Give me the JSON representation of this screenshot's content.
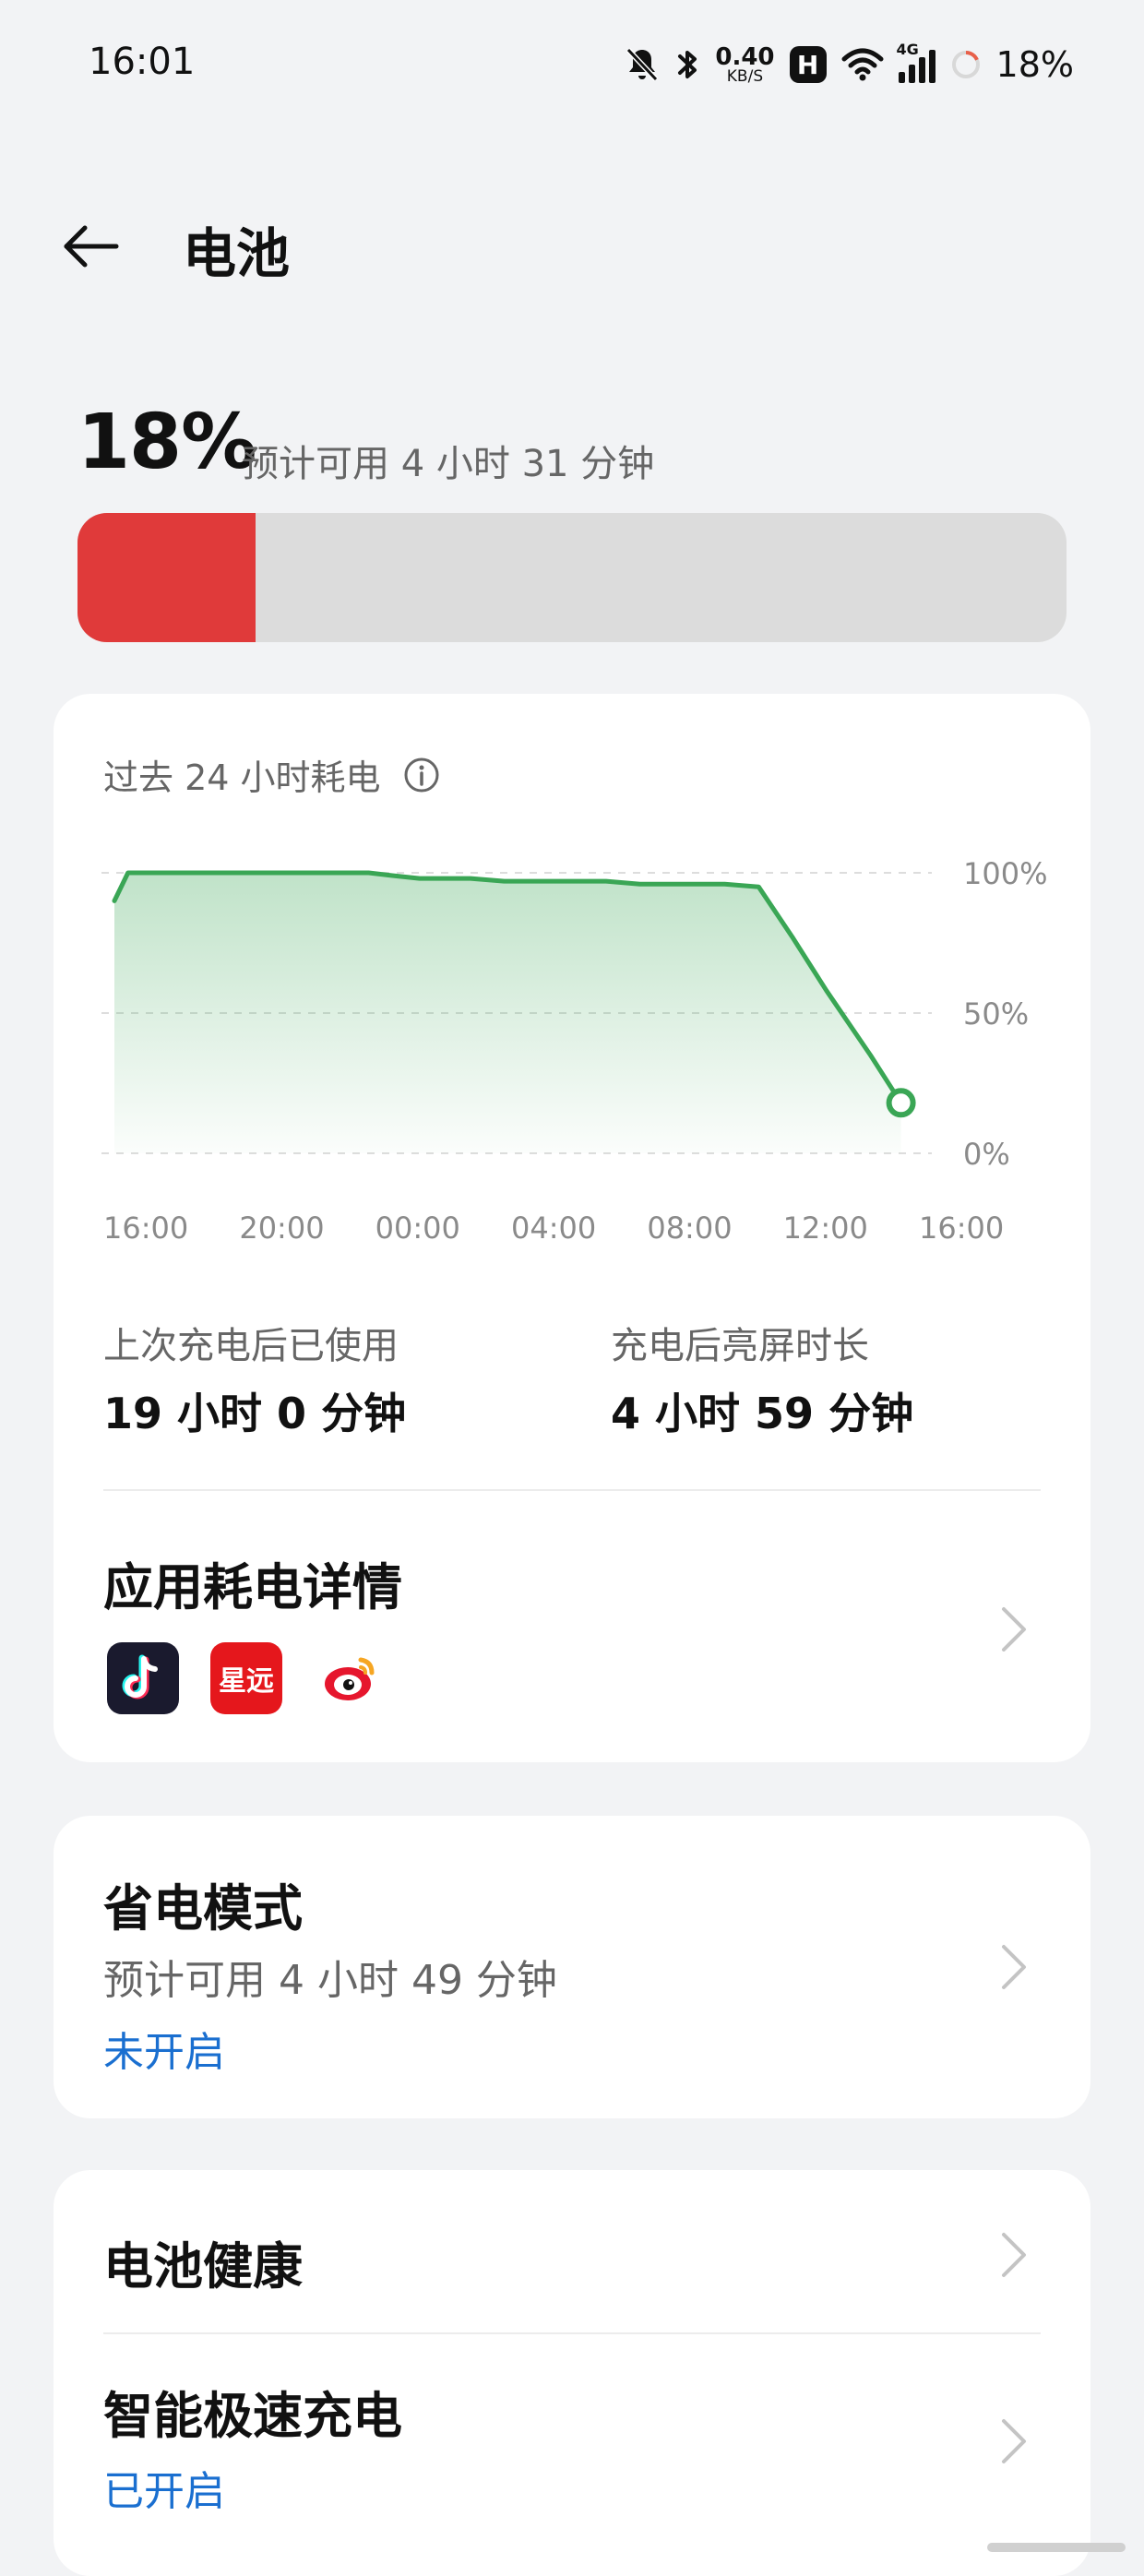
{
  "status_bar": {
    "time": "16:01",
    "net_speed_value": "0.40",
    "net_speed_unit": "KB/S",
    "hd_label": "H",
    "signal_label": "4G",
    "battery_text": "18%"
  },
  "header": {
    "title": "电池",
    "back_icon": "arrow-left-icon"
  },
  "battery": {
    "percent_text": "18%",
    "estimate": "预计可用 4 小时 31 分钟",
    "level_fraction": 0.18,
    "fill_color": "#e03a3a"
  },
  "usage": {
    "title": "过去 24 小时耗电",
    "info_icon": "info-icon"
  },
  "chart_data": {
    "type": "area",
    "title": "",
    "xlabel": "",
    "ylabel": "",
    "x_ticks": [
      "16:00",
      "20:00",
      "00:00",
      "04:00",
      "08:00",
      "12:00",
      "16:00"
    ],
    "y_ticks": [
      "100%",
      "50%",
      "0%"
    ],
    "ylim": [
      0,
      100
    ],
    "xlim_hours": [
      0,
      24
    ],
    "grid": true,
    "line_color": "#3aa655",
    "series": [
      {
        "x": [
          0,
          0.4,
          2,
          4,
          7.5,
          8.2,
          9,
          10.5,
          11.5,
          14.5,
          15.5,
          18,
          19,
          20,
          21,
          22.3,
          23.2
        ],
        "values": [
          90,
          100,
          100,
          100,
          100,
          99,
          98,
          98,
          97,
          97,
          96,
          96,
          95,
          77,
          58,
          35,
          18
        ]
      }
    ],
    "end_marker": true
  },
  "stats": [
    {
      "label": "上次充电后已使用",
      "value": "19 小时 0 分钟"
    },
    {
      "label": "充电后亮屏时长",
      "value": "4 小时 59 分钟"
    }
  ],
  "app_usage": {
    "title": "应用耗电详情",
    "apps": [
      {
        "icon": "douyin-icon",
        "color": "#1a1a2e"
      },
      {
        "icon": "xingtu-icon",
        "color": "#e5171c",
        "glyph": "星远"
      },
      {
        "icon": "weibo-icon",
        "color": "#e6162d"
      }
    ]
  },
  "power_saving": {
    "title": "省电模式",
    "estimate": "预计可用 4 小时 49 分钟",
    "status": "未开启"
  },
  "battery_health": {
    "title": "电池健康"
  },
  "fast_charge": {
    "title": "智能极速充电",
    "status": "已开启"
  },
  "colors": {
    "background": "#f2f3f5",
    "card": "#ffffff",
    "accent_blue": "#1a6fd0",
    "chart_green": "#3aa655",
    "battery_red": "#e03a3a"
  }
}
